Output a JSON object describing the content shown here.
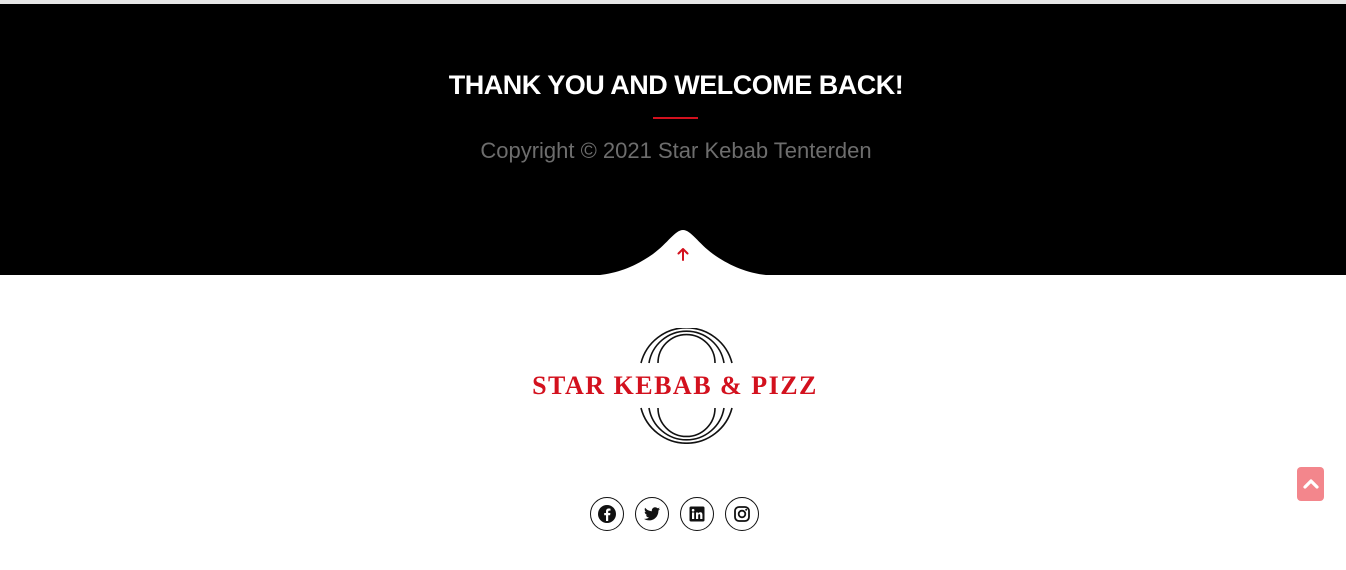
{
  "footer": {
    "title": "THANK YOU AND WELCOME BACK!",
    "copyright": "Copyright © 2021 Star Kebab Tenterden",
    "back_to_top_icon": "arrow-up-icon"
  },
  "logo": {
    "text": "STAR KEBAB & PIZZ"
  },
  "social": [
    {
      "name": "facebook",
      "icon": "facebook-icon"
    },
    {
      "name": "twitter",
      "icon": "twitter-icon"
    },
    {
      "name": "linkedin",
      "icon": "linkedin-icon"
    },
    {
      "name": "instagram",
      "icon": "instagram-icon"
    }
  ],
  "scroll_top": {
    "icon": "chevron-up-icon"
  },
  "colors": {
    "accent": "#d3111e",
    "background_dark": "#000000",
    "scroll_button": "#f3868c",
    "copyright_text": "#6d6d6d"
  }
}
